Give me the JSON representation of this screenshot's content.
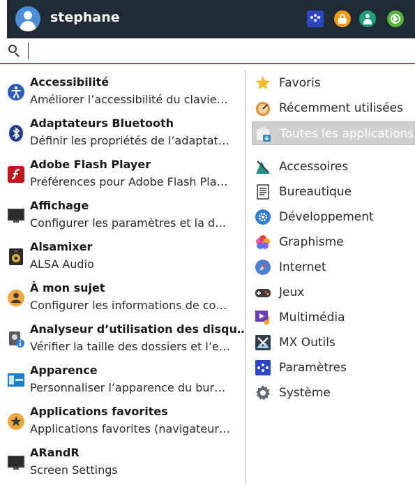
{
  "header": {
    "username": "stephane",
    "buttons": [
      "settings-icon",
      "lock-icon",
      "user-icon",
      "logout-icon"
    ],
    "colors": {
      "background": "#1f2a35",
      "settings": "#2d47c4",
      "lock": "#f59b1a",
      "user": "#1f9e7a",
      "logout": "#56b53a"
    }
  },
  "search": {
    "value": "",
    "placeholder": ""
  },
  "apps": [
    {
      "title": "Accessibilité",
      "desc": "Améliorer l’accessibilité du clavie…",
      "icon": "accessibility-icon"
    },
    {
      "title": "Adaptateurs Bluetooth",
      "desc": "Définir les propriétés de l’adaptat…",
      "icon": "bluetooth-icon"
    },
    {
      "title": "Adobe Flash Player",
      "desc": "Préférences pour Adobe Flash Pla…",
      "icon": "flash-icon"
    },
    {
      "title": "Affichage",
      "desc": "Configurer les paramètres et la d…",
      "icon": "display-icon"
    },
    {
      "title": "Alsamixer",
      "desc": "ALSA Audio",
      "icon": "speaker-icon"
    },
    {
      "title": "À mon sujet",
      "desc": "Configurer les informations de co…",
      "icon": "about-me-icon"
    },
    {
      "title": "Analyseur d’utilisation des disqu…",
      "desc": "Vérifier la taille des dossiers et l’e…",
      "icon": "disk-usage-icon"
    },
    {
      "title": "Apparence",
      "desc": "Personnaliser l’apparence du bur…",
      "icon": "appearance-icon"
    },
    {
      "title": "Applications favorites",
      "desc": "Applications favorites (navigateur…",
      "icon": "favorite-apps-icon"
    },
    {
      "title": "ARandR",
      "desc": "Screen Settings",
      "icon": "monitor-icon"
    }
  ],
  "categories": [
    {
      "label": "Favoris",
      "icon": "star-icon"
    },
    {
      "label": "Récemment utilisées",
      "icon": "recent-icon"
    },
    {
      "label": "Toutes les applications",
      "icon": "all-apps-icon",
      "selected": true
    },
    {
      "label": "Accessoires",
      "icon": "accessories-icon"
    },
    {
      "label": "Bureautique",
      "icon": "office-icon"
    },
    {
      "label": "Développement",
      "icon": "development-icon"
    },
    {
      "label": "Graphisme",
      "icon": "graphics-icon"
    },
    {
      "label": "Internet",
      "icon": "internet-icon"
    },
    {
      "label": "Jeux",
      "icon": "games-icon"
    },
    {
      "label": "Multimédia",
      "icon": "multimedia-icon"
    },
    {
      "label": "MX Outils",
      "icon": "mx-tools-icon"
    },
    {
      "label": "Paramètres",
      "icon": "settings-icon"
    },
    {
      "label": "Système",
      "icon": "system-icon"
    }
  ]
}
